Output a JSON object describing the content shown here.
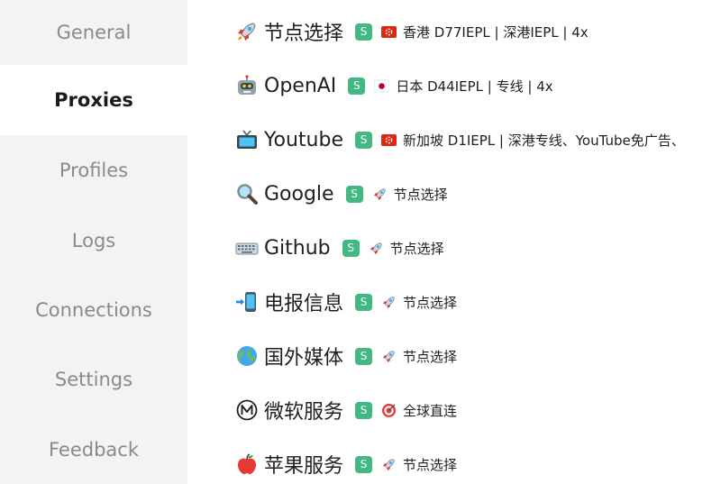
{
  "sidebar": {
    "items": [
      {
        "label": "General",
        "active": false
      },
      {
        "label": "Proxies",
        "active": true
      },
      {
        "label": "Profiles",
        "active": false
      },
      {
        "label": "Logs",
        "active": false
      },
      {
        "label": "Connections",
        "active": false
      },
      {
        "label": "Settings",
        "active": false
      },
      {
        "label": "Feedback",
        "active": false
      }
    ]
  },
  "proxies": {
    "type_badge": "S",
    "groups": [
      {
        "icon": "rocket-icon",
        "name": "节点选择",
        "selected_icon": "hong-kong-flag-icon",
        "selected": "香港 D77IEPL | 深港IEPL | 4x"
      },
      {
        "icon": "robot-icon",
        "name": "OpenAI",
        "selected_icon": "japan-flag-icon",
        "selected": "日本 D44IEPL | 专线 | 4x"
      },
      {
        "icon": "television-icon",
        "name": "Youtube",
        "selected_icon": "hong-kong-flag-icon",
        "selected": "新加坡 D1IEPL | 深港专线、YouTube免广告、"
      },
      {
        "icon": "magnifier-icon",
        "name": "Google",
        "selected_icon": "rocket-icon",
        "selected": "节点选择"
      },
      {
        "icon": "keyboard-icon",
        "name": "Github",
        "selected_icon": "rocket-icon",
        "selected": "节点选择"
      },
      {
        "icon": "phone-incoming-icon",
        "name": "电报信息",
        "selected_icon": "rocket-icon",
        "selected": "节点选择"
      },
      {
        "icon": "globe-icon",
        "name": "国外媒体",
        "selected_icon": "rocket-icon",
        "selected": "节点选择"
      },
      {
        "icon": "circled-m-icon",
        "name": "微软服务",
        "selected_icon": "target-icon",
        "selected": "全球直连"
      },
      {
        "icon": "apple-icon",
        "name": "苹果服务",
        "selected_icon": "rocket-icon",
        "selected": "节点选择"
      }
    ]
  },
  "colors": {
    "sidebar_bg": "#f3f3f3",
    "active_bg": "#ffffff",
    "badge_green": "#42b883",
    "inactive_text": "#8a8a8a"
  }
}
